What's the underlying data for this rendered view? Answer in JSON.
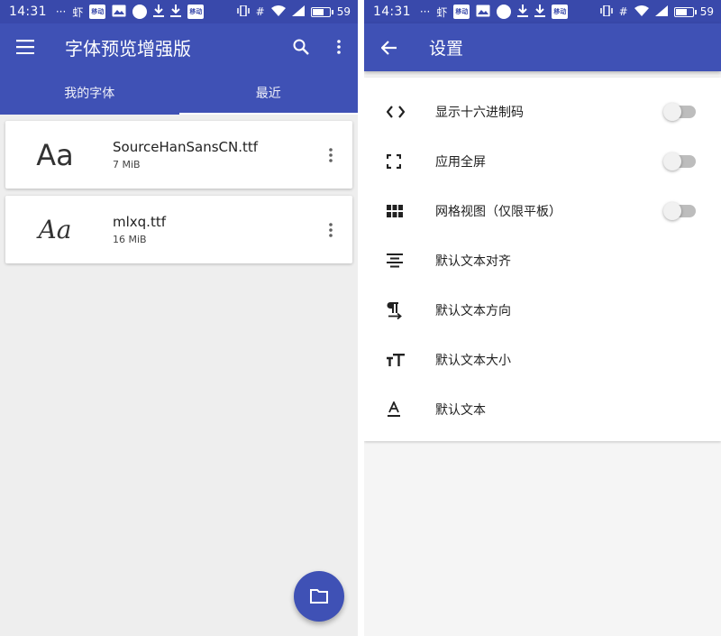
{
  "status_bar": {
    "time": "14:31",
    "dots": "···",
    "carrier_glyph": "虾",
    "badge_text": "移动",
    "hash": "#",
    "battery": "59",
    "battery_level": 0.59
  },
  "left": {
    "app_title": "字体预览增强版",
    "tabs": [
      {
        "label": "我的字体",
        "active": false
      },
      {
        "label": "最近",
        "active": true
      }
    ],
    "fonts": [
      {
        "preview": "Aa",
        "name": "SourceHanSansCN.ttf",
        "size": "7 MiB"
      },
      {
        "preview": "Aa",
        "name": "mlxq.ttf",
        "size": "16 MiB"
      }
    ]
  },
  "right": {
    "title": "设置",
    "settings": [
      {
        "icon": "code-icon",
        "label": "显示十六进制码",
        "switch_on": false
      },
      {
        "icon": "fullscreen-icon",
        "label": "应用全屏",
        "switch_on": false
      },
      {
        "icon": "grid-view-icon",
        "label": "网格视图（仅限平板）",
        "switch_on": false
      },
      {
        "icon": "align-center-icon",
        "label": "默认文本对齐"
      },
      {
        "icon": "text-direction-icon",
        "label": "默认文本方向"
      },
      {
        "icon": "text-size-icon",
        "label": "默认文本大小"
      },
      {
        "icon": "text-format-icon",
        "label": "默认文本"
      }
    ]
  },
  "colors": {
    "primary": "#3f51b5",
    "status_bar": "#3949ab",
    "background": "#eeeeee",
    "card": "#ffffff"
  }
}
